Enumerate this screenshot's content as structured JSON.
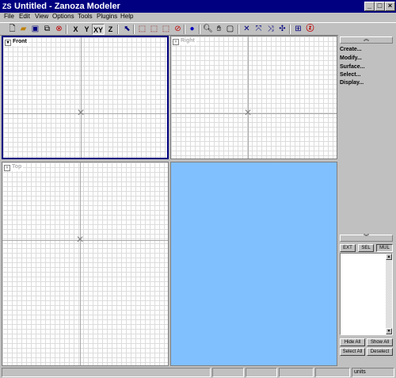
{
  "window": {
    "app_icon": "ZS",
    "title": "Untitled - Zanoza Modeler",
    "minimize": "_",
    "maximize": "□",
    "close": "×"
  },
  "menu": [
    "File",
    "Edit",
    "View",
    "Options",
    "Tools",
    "Plugins",
    "Help"
  ],
  "toolbar": {
    "axis_buttons": [
      "X",
      "Y",
      "XY",
      "Z"
    ],
    "pressed": "XY",
    "icons": [
      "new-file-icon",
      "open-folder-icon",
      "save-icon",
      "copy-icon",
      "render-icon",
      "select-arrow-icon",
      "cube-view-icon",
      "cube-solid-icon",
      "cube-wire-icon",
      "cube-none-icon",
      "sphere-icon",
      "zoom-icon",
      "hand-pan-icon",
      "zoom-extents-icon",
      "move-vertices-icon",
      "move-edges-icon",
      "rotate-icon",
      "scale-icon",
      "plugin-icon",
      "help-z-icon"
    ]
  },
  "viewports": {
    "front": "Front",
    "right": "Right",
    "top": "Top"
  },
  "panel": {
    "menu": [
      "Create...",
      "Modify...",
      "Surface...",
      "Select...",
      "Display..."
    ],
    "mode_buttons": [
      "EXT",
      "SEL",
      "MUL"
    ],
    "hide_all": "Hide All",
    "show_all": "Show All",
    "select_all": "Select All",
    "deselect": "Deselect"
  },
  "status": {
    "units": "units"
  },
  "colors": {
    "titlebar": "#000080",
    "render_bg": "#80c0ff",
    "chrome": "#c0c0c0"
  }
}
